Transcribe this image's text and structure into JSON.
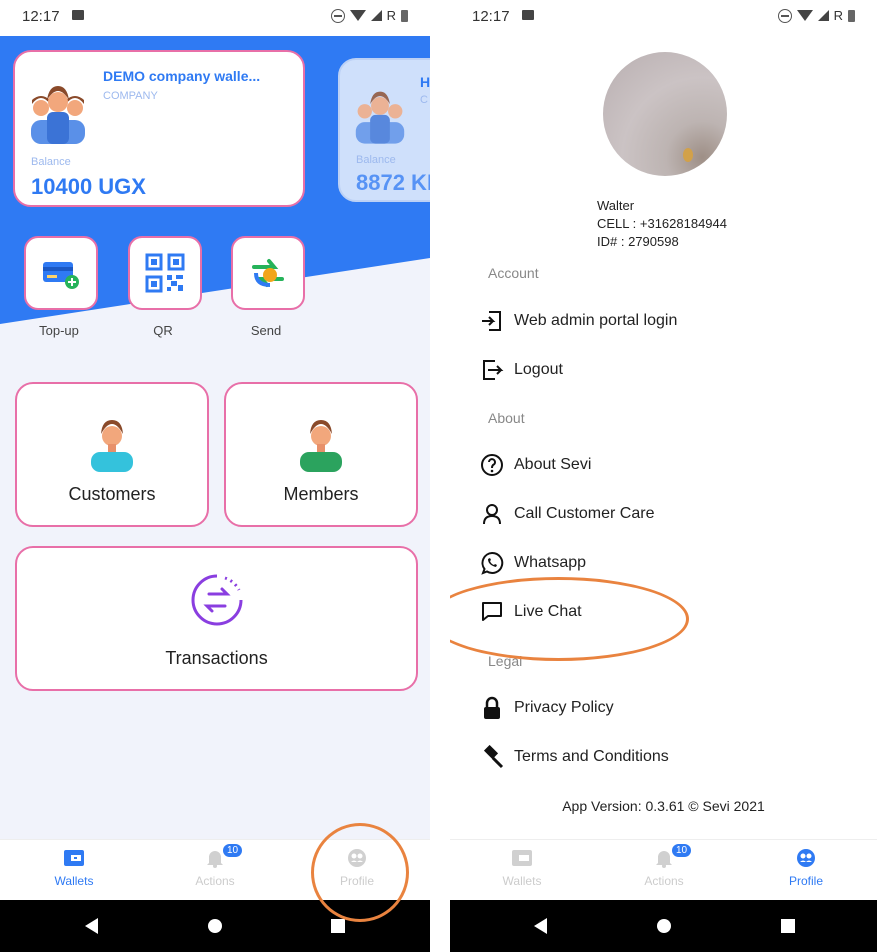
{
  "status_bar": {
    "time": "12:17",
    "network_letter": "R"
  },
  "left": {
    "wallets": [
      {
        "title": "DEMO company walle...",
        "type": "COMPANY",
        "balance_label": "Balance",
        "balance": "10400 UGX"
      },
      {
        "title": "H",
        "type": "C",
        "balance_label": "Balance",
        "balance": "8872 KE"
      }
    ],
    "quick_actions": [
      {
        "label": "Top-up",
        "icon": "card-add-icon"
      },
      {
        "label": "QR",
        "icon": "qr-code-icon"
      },
      {
        "label": "Send",
        "icon": "transfer-icon"
      }
    ],
    "tiles": {
      "customers": "Customers",
      "members": "Members",
      "transactions": "Transactions"
    },
    "bottom_nav": [
      {
        "label": "Wallets",
        "icon": "wallet-icon",
        "active": true
      },
      {
        "label": "Actions",
        "icon": "bell-icon",
        "badge": "10"
      },
      {
        "label": "Profile",
        "icon": "profile-icon"
      }
    ],
    "accent": "#2f7af3"
  },
  "right": {
    "profile": {
      "name": "Walter",
      "cell": "CELL : +31628184944",
      "id": "ID# :  2790598"
    },
    "sections": {
      "account": "Account",
      "about": "About",
      "legal": "Legal"
    },
    "menu": {
      "web_admin": "Web admin portal login",
      "logout": "Logout",
      "about_sevi": "About Sevi",
      "call_care": "Call Customer Care",
      "whatsapp": "Whatsapp",
      "live_chat": "Live Chat",
      "privacy": "Privacy Policy",
      "terms": "Terms and Conditions"
    },
    "version": "App Version: 0.3.61 © Sevi 2021",
    "bottom_nav": [
      {
        "label": "Wallets",
        "icon": "wallet-icon"
      },
      {
        "label": "Actions",
        "icon": "bell-icon",
        "badge": "10"
      },
      {
        "label": "Profile",
        "icon": "profile-icon",
        "active": true
      }
    ]
  },
  "highlight_color": "#e9833f"
}
